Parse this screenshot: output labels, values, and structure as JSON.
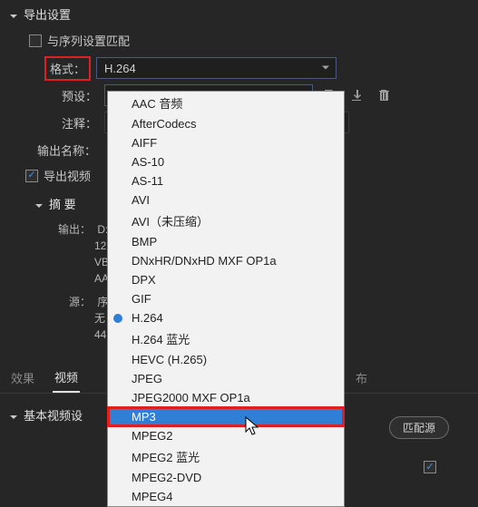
{
  "section": {
    "title": "导出设置",
    "match_sequence": "与序列设置匹配",
    "labels": {
      "format": "格式：",
      "preset": "预设：",
      "comment": "注释：",
      "output_name": "输出名称：",
      "export_video": "导出视频",
      "summary": "摘 要",
      "output": "输出：",
      "source": "源："
    },
    "format_value": "H.264",
    "summary_output_lines": [
      "D:\\",
      "12",
      "VB",
      "AA"
    ],
    "summary_source_lines": [
      "序",
      "无",
      "44"
    ]
  },
  "tabs": {
    "effects": "效果",
    "video": "视频",
    "right_tab": "布"
  },
  "sub_section": {
    "title": "基本视频设",
    "match_source": "匹配源"
  },
  "dropdown": {
    "items": [
      "AAC 音频",
      "AfterCodecs",
      "AIFF",
      "AS-10",
      "AS-11",
      "AVI",
      "AVI（未压缩）",
      "BMP",
      "DNxHR/DNxHD MXF OP1a",
      "DPX",
      "GIF",
      "H.264",
      "H.264 蓝光",
      "HEVC (H.265)",
      "JPEG",
      "JPEG2000 MXF OP1a",
      "MP3",
      "MPEG2",
      "MPEG2 蓝光",
      "MPEG2-DVD",
      "MPEG4"
    ],
    "selected_index": 11,
    "highlight_index": 16,
    "redbox_index": 16
  }
}
